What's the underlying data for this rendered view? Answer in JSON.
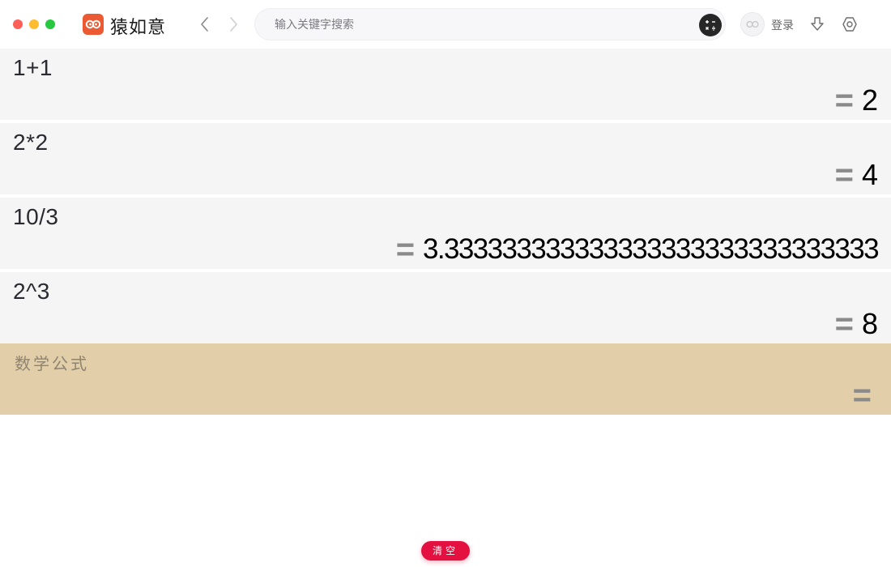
{
  "app": {
    "name": "猿如意",
    "brand_color": "#ec5a33"
  },
  "toolbar": {
    "search_placeholder": "输入关键字搜索",
    "login_label": "登录",
    "icons": {
      "back": "chevron-left-icon",
      "forward": "chevron-right-icon",
      "calculator": "calculator-icon",
      "download": "download-icon",
      "settings": "settings-icon"
    }
  },
  "calculations": [
    {
      "expression": "1+1",
      "equals": "=",
      "result": "2"
    },
    {
      "expression": "2*2",
      "equals": "=",
      "result": "4"
    },
    {
      "expression": "10/3",
      "equals": "=",
      "result": "3.333333333333333333333333333333"
    },
    {
      "expression": "2^3",
      "equals": "=",
      "result": "8"
    }
  ],
  "input": {
    "placeholder": "数学公式",
    "value": "",
    "equals": "="
  },
  "clear_button": {
    "label": "清空",
    "color": "#e4103f"
  }
}
